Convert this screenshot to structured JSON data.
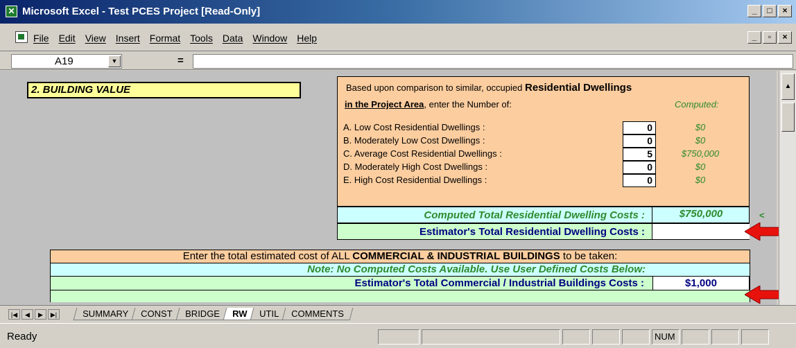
{
  "window": {
    "title": "Microsoft Excel - Test PCES Project  [Read-Only]",
    "buttons": [
      "_",
      "□",
      "×"
    ]
  },
  "menubar": {
    "items": [
      "File",
      "Edit",
      "View",
      "Insert",
      "Format",
      "Tools",
      "Data",
      "Window",
      "Help"
    ],
    "doc_buttons": [
      "_",
      "▫",
      "×"
    ]
  },
  "formula_bar": {
    "cell_ref": "A19",
    "equals": "=",
    "formula": ""
  },
  "section": {
    "title": "2.  BUILDING VALUE"
  },
  "residential": {
    "intro_prefix": "Based upon comparison to similar, occupied ",
    "intro_bold": "Residential Dwellings",
    "area_bold": "in the Project Area",
    "area_rest": ", enter the Number of:",
    "computed_header": "Computed:",
    "rows": [
      {
        "label": "A.  Low Cost Residential Dwellings :",
        "qty": "0",
        "cost": "$0"
      },
      {
        "label": "B.  Moderately Low Cost Dwellings :",
        "qty": "0",
        "cost": "$0"
      },
      {
        "label": "C.  Average Cost Residential Dwellings :",
        "qty": "5",
        "cost": "$750,000"
      },
      {
        "label": "D.  Moderately High Cost Dwellings :",
        "qty": "0",
        "cost": "$0"
      },
      {
        "label": "E.  High Cost Residential Dwellings :",
        "qty": "0",
        "cost": "$0"
      }
    ],
    "computed_total_label": "Computed Total Residential Dwelling Costs :",
    "computed_total_value": "$750,000",
    "estimator_label": "Estimator's Total Residential Dwelling Costs :",
    "estimator_value": "",
    "marker": "<"
  },
  "commercial": {
    "intro_prefix": "Enter the total estimated cost of ALL ",
    "intro_bold": "COMMERCIAL & INDUSTRIAL BUILDINGS",
    "intro_suffix": " to be taken:",
    "note": "Note:  No Computed Costs Available.  Use User Defined Costs Below:",
    "estimator_label": "Estimator's Total Commercial / Industrial Buildings Costs :",
    "estimator_value": "$1,000"
  },
  "sheet_tabs": {
    "nav": [
      "|◀",
      "◀",
      "▶",
      "▶|"
    ],
    "tabs": [
      "SUMMARY",
      "CONST",
      "BRIDGE",
      "RW",
      "UTIL",
      "COMMENTS"
    ],
    "active": "RW"
  },
  "status": {
    "text": "Ready",
    "num": "NUM"
  },
  "colors": {
    "accent_green": "#2e8b2e",
    "arrow_red": "#e8120c",
    "panel_orange": "#fbcd9f",
    "panel_cyan": "#ccffff",
    "panel_green": "#ccffcc",
    "header_yellow": "#ffff99"
  }
}
